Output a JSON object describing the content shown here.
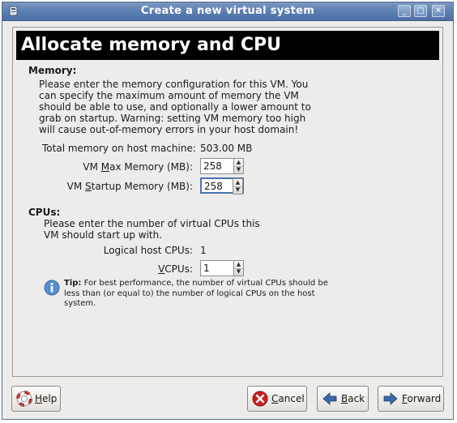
{
  "window": {
    "title": "Create a new virtual system"
  },
  "banner": {
    "title": "Allocate memory and CPU"
  },
  "memory": {
    "section_title": "Memory:",
    "description": "Please enter the memory configuration for this VM. You\ncan specify the maximum amount of memory the VM\nshould be able to use, and optionally a lower amount to\ngrab on startup. Warning: setting VM memory too high\nwill cause out-of-memory errors in your host domain!",
    "total_label": "Total memory on host machine:",
    "total_value": "503.00 MB",
    "max_label_pre": "VM ",
    "max_label_mnemonic": "M",
    "max_label_post": "ax Memory (MB):",
    "max_value": "258",
    "startup_label_pre": "VM ",
    "startup_label_mnemonic": "S",
    "startup_label_post": "tartup Memory (MB):",
    "startup_value": "258"
  },
  "cpus": {
    "section_title": "CPUs:",
    "description": "Please enter the number of virtual CPUs this\nVM should start up with.",
    "logical_label": "Logical host CPUs:",
    "logical_value": "1",
    "vcpus_label_mnemonic": "V",
    "vcpus_label_post": "CPUs:",
    "vcpus_value": "1",
    "tip_bold": "Tip:",
    "tip_text": " For best performance, the number of virtual CPUs should be\nless than (or equal to) the number of logical CPUs on the host\nsystem."
  },
  "buttons": {
    "help_mnemonic": "H",
    "help_rest": "elp",
    "cancel_mnemonic": "C",
    "cancel_rest": "ancel",
    "back_mnemonic": "B",
    "back_rest": "ack",
    "forward_mnemonic": "F",
    "forward_rest": "orward"
  },
  "colors": {
    "titlebar": "#5a7db0",
    "banner_bg": "#000000",
    "window_bg": "#edeceb",
    "focus": "#4a74b0",
    "cancel_icon": "#cc1f1f",
    "nav_arrow": "#3b67a8",
    "info_icon": "#5b8ed0"
  },
  "icons": [
    "app-icon",
    "minimize-icon",
    "maximize-icon",
    "close-icon",
    "info-icon",
    "lifebuoy-icon",
    "cancel-icon",
    "back-arrow-icon",
    "forward-arrow-icon"
  ]
}
